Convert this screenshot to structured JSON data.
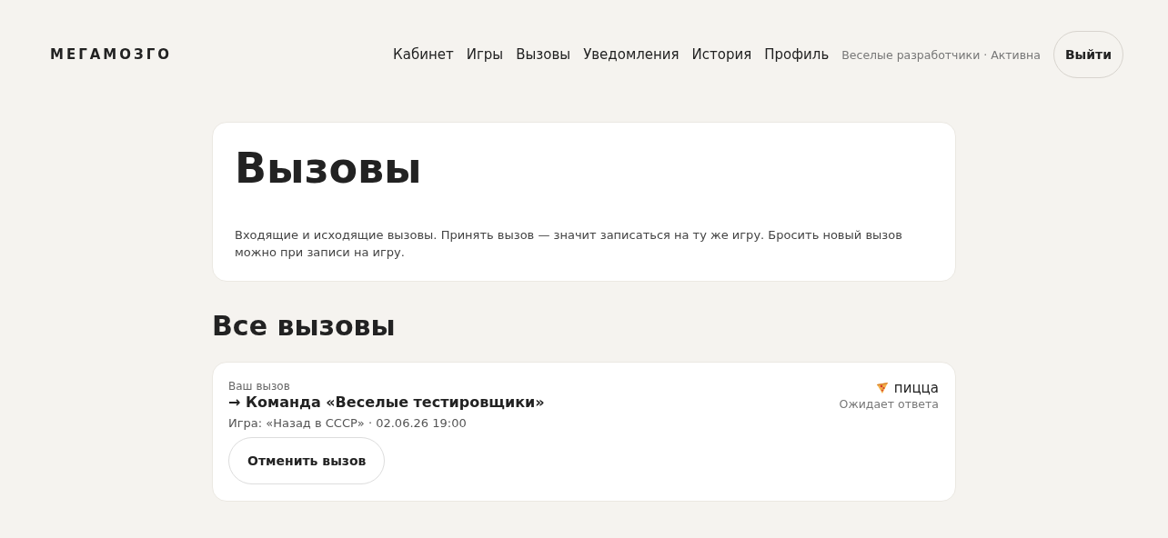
{
  "header": {
    "logo": "МЕГАМОЗГО",
    "nav": [
      "Кабинет",
      "Игры",
      "Вызовы",
      "Уведомления",
      "История",
      "Профиль"
    ],
    "team_status": "Веселые разработчики · Активна",
    "logout": "Выйти"
  },
  "intro": {
    "title": "Вызовы",
    "description": "Входящие и исходящие вызовы. Принять вызов — значит записаться на ту же игру. Бросить новый вызов можно при записи на игру."
  },
  "section_title": "Все вызовы",
  "challenges": [
    {
      "direction": "Ваш вызов",
      "team": "→ Команда «Веселые тестировщики»",
      "game": "Игра: «Назад в СССР» · 02.06.26 19:00",
      "stake": "пицца",
      "status": "Ожидает ответа",
      "action": "Отменить вызов"
    }
  ]
}
